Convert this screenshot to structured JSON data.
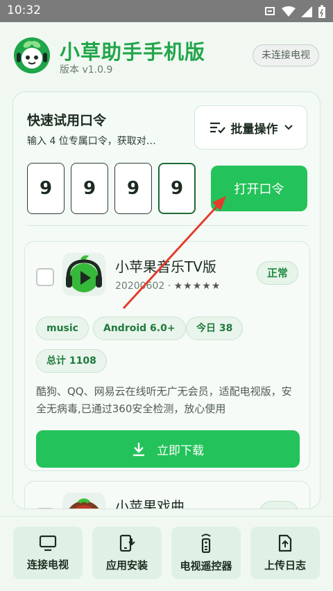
{
  "status_bar": {
    "time": "10:32"
  },
  "header": {
    "title": "小草助手手机版",
    "version": "版本 v1.0.9",
    "connection_status": "未连接电视"
  },
  "quick": {
    "title": "快速试用口令",
    "subtitle": "输入 4 位专属口令，获取对…",
    "batch_label": "批量操作",
    "digits": [
      "9",
      "9",
      "9",
      "9"
    ],
    "open_label": "打开口令"
  },
  "apps": [
    {
      "name": "小苹果音乐TV版",
      "version": "20200602",
      "rating": "★★★★★",
      "status": "正常",
      "tags": [
        "music",
        "Android 6.0+",
        "今日 38",
        "总计 1108"
      ],
      "description": "酷狗、QQ、网易云在线听无广无会员，适配电视版，安全无病毒,已通过360安全检测，放心使用",
      "download_label": "立即下载"
    },
    {
      "name": "小苹果戏曲"
    }
  ],
  "bottom_nav": [
    {
      "label": "连接电视",
      "icon": "tv-icon"
    },
    {
      "label": "应用安装",
      "icon": "phone-install-icon"
    },
    {
      "label": "电视遥控器",
      "icon": "remote-icon"
    },
    {
      "label": "上传日志",
      "icon": "upload-file-icon"
    }
  ],
  "colors": {
    "brand_green": "#23c25a",
    "annotation_arrow": "#e53b2c"
  }
}
